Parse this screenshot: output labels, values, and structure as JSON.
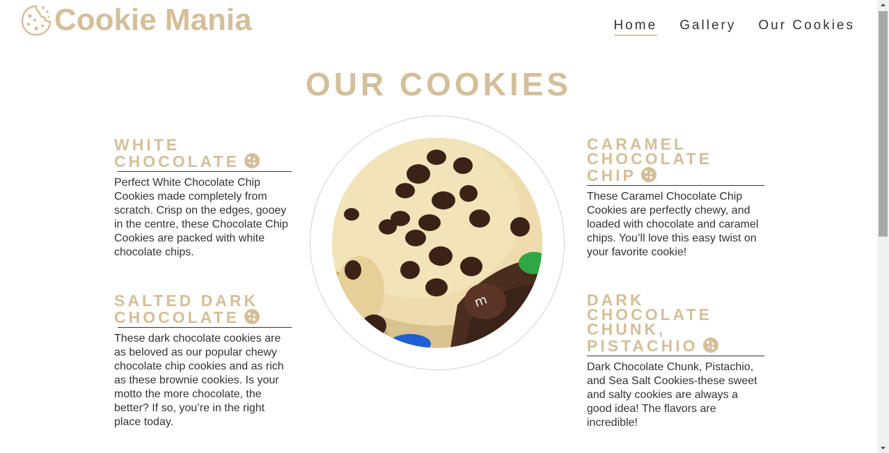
{
  "brand": {
    "name": "Cookie Mania",
    "icon": "cookie-icon",
    "color": "#d4bf99"
  },
  "nav": {
    "items": [
      {
        "label": "Home",
        "active": true
      },
      {
        "label": "Gallery"
      },
      {
        "label": "Our Cookies"
      }
    ]
  },
  "page_title": "OUR COOKIES",
  "cookies": [
    {
      "title_lines": [
        "WHITE",
        "CHOCOLATE"
      ],
      "icon": "cookie-icon",
      "description": "Perfect White Chocolate Chip Cookies made completely from scratch. Crisp on the edges, gooey in the centre, these Chocolate Chip Cookies are packed with white chocolate chips."
    },
    {
      "title_lines": [
        "CARAMEL",
        "CHOCOLATE",
        "CHIP"
      ],
      "icon": "cookie-icon",
      "description": "These Caramel Chocolate Chip Cookies are perfectly chewy, and loaded with chocolate and caramel chips. You’ll love this easy twist on your favorite cookie!"
    },
    {
      "title_lines": [
        "SALTED DARK",
        "CHOCOLATE"
      ],
      "icon": "cookie-icon",
      "description": "These dark chocolate cookies are as beloved as our popular chewy chocolate chip cookies and as rich as these brownie cookies. Is your motto the more chocolate, the better? If so, you’re in the right place today."
    },
    {
      "title_lines": [
        "DARK",
        "CHOCOLATE",
        "CHUNK,",
        "PISTACHIO"
      ],
      "icon": "cookie-icon",
      "description": "Dark Chocolate Chunk, Pistachio, and Sea Salt Cookies-these sweet and salty cookies are always a good idea! The flavors are incredible!"
    }
  ],
  "featured_image": {
    "subject": "chocolate chip cookies with M&M candies"
  }
}
